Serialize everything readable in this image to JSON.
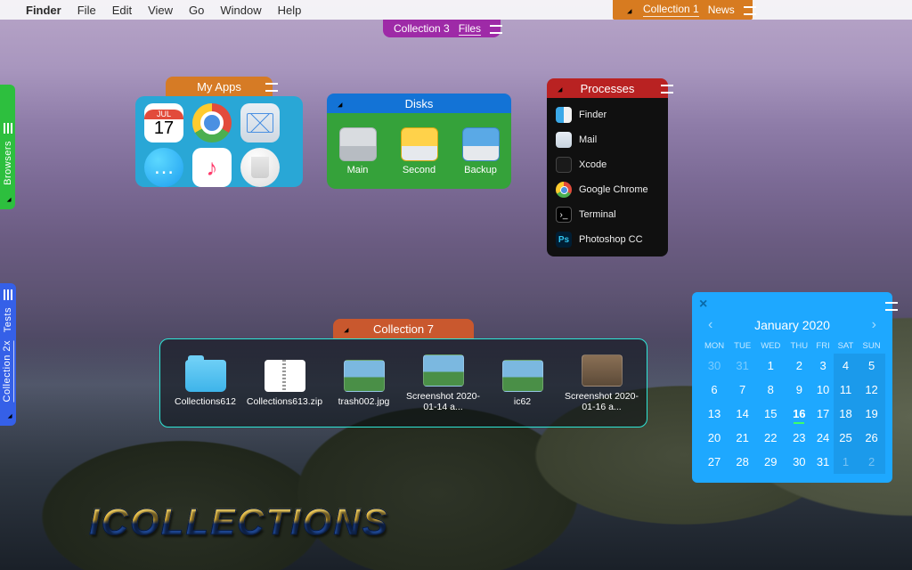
{
  "menubar": {
    "app": "Finder",
    "items": [
      "File",
      "Edit",
      "View",
      "Go",
      "Window",
      "Help"
    ]
  },
  "top_orange_tab": {
    "label1": "Collection 1",
    "label2": "News"
  },
  "purple_tab": {
    "label1": "Collection 3",
    "label2": "Files"
  },
  "side_green": {
    "label": "Browsers"
  },
  "side_blue": {
    "label1": "Collection 2x",
    "label2": "Tests"
  },
  "myapps": {
    "title": "My Apps",
    "cal_month": "JUL",
    "cal_day": "17"
  },
  "disks": {
    "title": "Disks",
    "items": [
      "Main",
      "Second",
      "Backup"
    ]
  },
  "processes": {
    "title": "Processes",
    "items": [
      "Finder",
      "Mail",
      "Xcode",
      "Google Chrome",
      "Terminal",
      "Photoshop CC"
    ]
  },
  "col7": {
    "title": "Collection 7",
    "items": [
      "Collections612",
      "Collections613.zip",
      "trash002.jpg",
      "Screenshot 2020-01-14 a...",
      "ic62",
      "Screenshot 2020-01-16 a..."
    ]
  },
  "calendar": {
    "title": "January 2020",
    "dow": [
      "MON",
      "TUE",
      "WED",
      "THU",
      "FRI",
      "SAT",
      "SUN"
    ],
    "rows": [
      [
        "30",
        "31",
        "1",
        "2",
        "3",
        "4",
        "5"
      ],
      [
        "6",
        "7",
        "8",
        "9",
        "10",
        "11",
        "12"
      ],
      [
        "13",
        "14",
        "15",
        "16",
        "17",
        "18",
        "19"
      ],
      [
        "20",
        "21",
        "22",
        "23",
        "24",
        "25",
        "26"
      ],
      [
        "27",
        "28",
        "29",
        "30",
        "31",
        "1",
        "2"
      ]
    ],
    "other_cells": [
      "0,0",
      "0,1",
      "4,5",
      "4,6"
    ],
    "today": "2,3"
  },
  "logo": "ICOLLECTIONS"
}
